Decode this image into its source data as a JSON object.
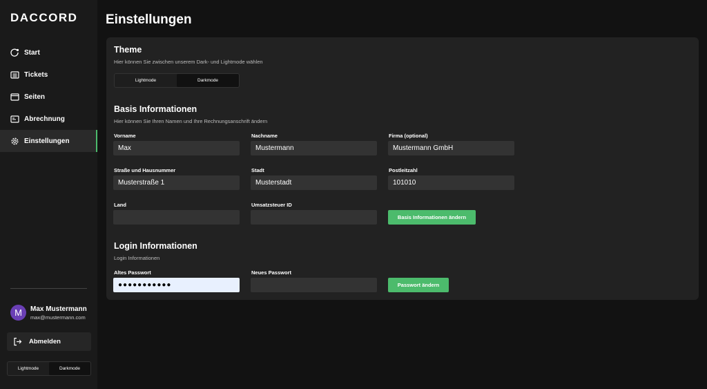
{
  "app": {
    "logo": "DACCORD"
  },
  "sidebar": {
    "items": [
      {
        "label": "Start",
        "icon": "start-icon"
      },
      {
        "label": "Tickets",
        "icon": "tickets-icon"
      },
      {
        "label": "Seiten",
        "icon": "pages-icon"
      },
      {
        "label": "Abrechnung",
        "icon": "billing-icon"
      },
      {
        "label": "Einstellungen",
        "icon": "gear-icon",
        "active": true
      }
    ],
    "user": {
      "initial": "M",
      "name": "Max Mustermann",
      "email": "max@mustermann.com"
    },
    "logout_label": "Abmelden",
    "theme_toggle": {
      "light": "Lightmode",
      "dark": "Darkmode",
      "selected": "Darkmode"
    }
  },
  "page": {
    "title": "Einstellungen"
  },
  "theme_section": {
    "title": "Theme",
    "description": "Hier können Sie zwischen unserem Dark- und Lightmode wählen",
    "light": "Lightmode",
    "dark": "Darkmode",
    "selected": "Darkmode"
  },
  "basis": {
    "title": "Basis Informationen",
    "description": "Hier können Sie Ihren Namen und Ihre Rechnungsanschrift ändern",
    "fields": {
      "vorname": {
        "label": "Vorname",
        "value": "Max"
      },
      "nachname": {
        "label": "Nachname",
        "value": "Mustermann"
      },
      "firma": {
        "label": "Firma (optional)",
        "value": "Mustermann GmbH"
      },
      "strasse": {
        "label": "Straße und Hausnummer",
        "value": "Musterstraße 1"
      },
      "stadt": {
        "label": "Stadt",
        "value": "Musterstadt"
      },
      "plz": {
        "label": "Postleitzahl",
        "value": "101010"
      },
      "land": {
        "label": "Land",
        "value": ""
      },
      "ust": {
        "label": "Umsatzsteuer ID",
        "value": ""
      }
    },
    "submit_label": "Basis Informationen ändern"
  },
  "login": {
    "title": "Login Informationen",
    "description": "Login Informationen",
    "old_password": {
      "label": "Altes Passwort",
      "value": "●●●●●●●●●●●"
    },
    "new_password": {
      "label": "Neues Passwort",
      "value": ""
    },
    "submit_label": "Passwort ändern"
  },
  "colors": {
    "accent": "#4cbb6c",
    "background": "#121212",
    "sidebar": "#1a1a1a",
    "card": "#222222",
    "input": "#333333",
    "avatar": "#6a3fb5"
  }
}
